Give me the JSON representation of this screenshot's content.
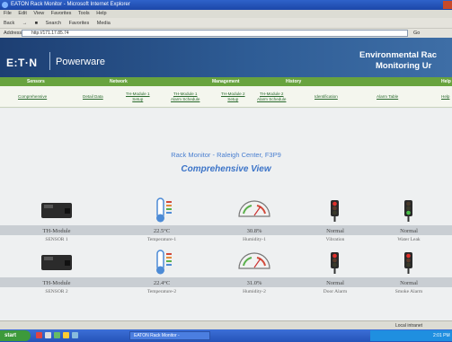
{
  "browser": {
    "window_title": "EATON Rack Monitor - Microsoft Internet Explorer",
    "menu": [
      "File",
      "Edit",
      "View",
      "Favorites",
      "Tools",
      "Help"
    ],
    "toolbar": [
      "Back",
      "Search",
      "Favorites",
      "Media"
    ],
    "address_label": "Address",
    "address_value": "http://171.17.85.74",
    "go_label": "Go",
    "status_zone": "Local intranet"
  },
  "header": {
    "logo": "E:T·N",
    "brand": "Powerware",
    "title_line1": "Environmental Rac",
    "title_line2": "Monitoring Ur"
  },
  "nav": {
    "primary": [
      "Sensors",
      "Network",
      "Management",
      "History",
      "Help"
    ],
    "secondary": [
      {
        "l1": "Comprehensive",
        "l2": ""
      },
      {
        "l1": "Detail Data",
        "l2": ""
      },
      {
        "l1": "TH-Module 1",
        "l2": "Setup"
      },
      {
        "l1": "TH-Module 1",
        "l2": "Alarm Schedule"
      },
      {
        "l1": "TH-Module 2",
        "l2": "Setup"
      },
      {
        "l1": "TH-Module 2",
        "l2": "Alarm Schedule"
      },
      {
        "l1": "Identification",
        "l2": ""
      },
      {
        "l1": "Alarm Table",
        "l2": ""
      },
      {
        "l1": "Help",
        "l2": ""
      }
    ]
  },
  "main": {
    "location": "Rack Monitor - Raleigh Center, F3P9",
    "view_title": "Comprehensive View"
  },
  "sensor_rows": [
    {
      "cells": [
        {
          "status": "TH-Module",
          "label": "SENSOR 1",
          "icon": "th-module-icon"
        },
        {
          "status": "22.5°C",
          "label": "Temperature-1",
          "icon": "thermometer-icon"
        },
        {
          "status": "30.8%",
          "label": "Humidity-1",
          "icon": "humidity-gauge-icon"
        },
        {
          "status": "Normal",
          "label": "Vibration",
          "icon": "traffic-light-red-icon"
        },
        {
          "status": "Normal",
          "label": "Water Leak",
          "icon": "traffic-light-green-icon"
        }
      ]
    },
    {
      "cells": [
        {
          "status": "TH-Module",
          "label": "SENSOR 2",
          "icon": "th-module-icon"
        },
        {
          "status": "22.4°C",
          "label": "Temperature-2",
          "icon": "thermometer-icon"
        },
        {
          "status": "31.0%",
          "label": "Humidity-2",
          "icon": "humidity-gauge-icon"
        },
        {
          "status": "Normal",
          "label": "Door Alarm",
          "icon": "traffic-light-red-icon"
        },
        {
          "status": "Normal",
          "label": "Smoke Alarm",
          "icon": "traffic-light-red-icon"
        }
      ]
    }
  ],
  "taskbar": {
    "start_label": "start",
    "task_label": "EATON Rack Monitor -",
    "clock": "2:01 PM"
  },
  "colors": {
    "header": "#1d3f73",
    "nav_green": "#68a33e",
    "link_green": "#2a6a2e",
    "title_blue": "#3c74c8"
  }
}
